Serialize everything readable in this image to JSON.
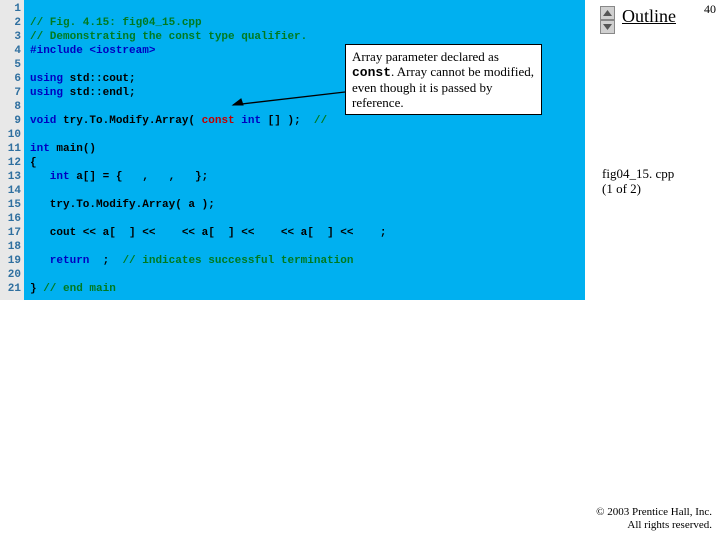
{
  "page_number": "40",
  "outline_label": "Outline",
  "figref": {
    "file": "fig04_15. cpp",
    "part": "(1 of 2)"
  },
  "copyright": {
    "line1": "© 2003 Prentice Hall, Inc.",
    "line2": "All rights reserved."
  },
  "gutter": [
    "1",
    "2",
    "3",
    "4",
    "5",
    "6",
    "7",
    "8",
    "9",
    "10",
    "11",
    "12",
    "13",
    "14",
    "15",
    "16",
    "17",
    "18",
    "19",
    "20",
    "21"
  ],
  "callout": {
    "t1": "Array parameter declared as ",
    "kw": "const",
    "t2": ". Array cannot be modified, even though it is passed by reference."
  },
  "code": {
    "l1": "// Fig. 4.15: fig04_15.cpp",
    "l2": "// Demonstrating the const type qualifier.",
    "l3a": "#include ",
    "l3b": "<iostream>",
    "l5a": "using",
    "l5b": " std::cout;",
    "l6a": "using",
    "l6b": " std::endl;",
    "l8a": "void",
    "l8b": " try.To.Modify.Array( ",
    "l8c": "const",
    "l8d": " ",
    "l8e": "int",
    "l8f": " [] );  ",
    "l8g": "// ",
    "l10a": "int",
    "l10b": " main()",
    "l11": "{",
    "l12a": "   int",
    "l12b": " a[] = {   ,   ,   };",
    "l14": "   try.To.Modify.Array( a );",
    "l16a": "   cout << a[  ] << ",
    "l16b": "   << a[  ] << ",
    "l16c": "   << a[  ] << ",
    "l16d": "   ;",
    "l18a": "   return",
    "l18b": "  ;  ",
    "l18c": "// indicates successful termination",
    "l20a": "} ",
    "l20b": "// end main"
  }
}
